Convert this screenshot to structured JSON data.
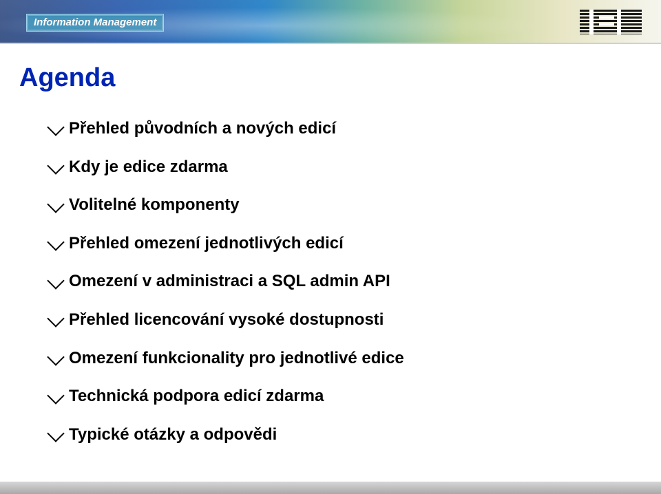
{
  "header": {
    "brand_label": "Information Management"
  },
  "page": {
    "title": "Agenda"
  },
  "bullets": [
    "Přehled původních a nových edicí",
    "Kdy je edice zdarma",
    "Volitelné komponenty",
    "Přehled omezení jednotlivých edicí",
    "Omezení v administraci a SQL admin API",
    "Přehled licencování vysoké dostupnosti",
    "Omezení funkcionality pro jednotlivé edice",
    "Technická podpora edicí zdarma",
    "Typické otázky a odpovědi"
  ]
}
